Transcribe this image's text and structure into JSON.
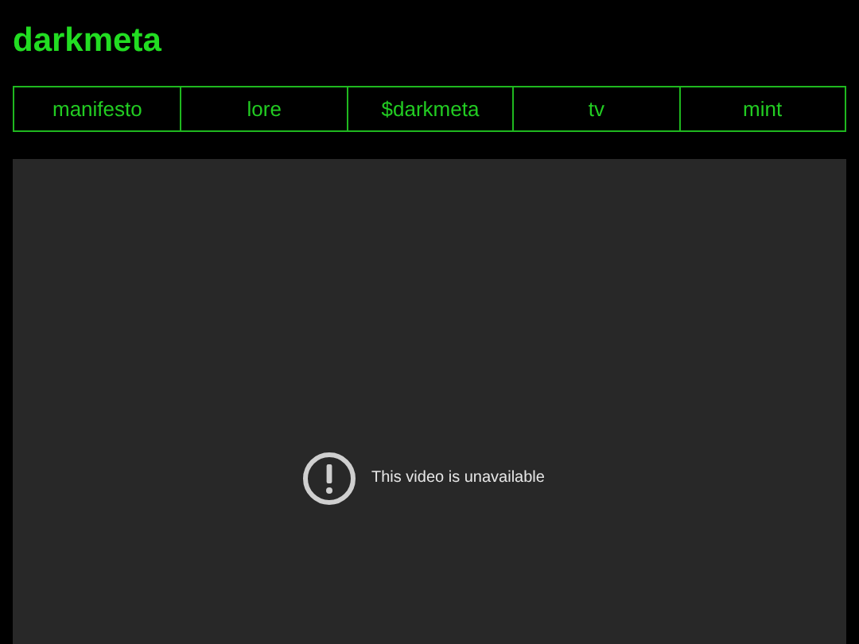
{
  "site_title": "darkmeta",
  "nav": [
    {
      "label": "manifesto"
    },
    {
      "label": "lore"
    },
    {
      "label": "$darkmeta"
    },
    {
      "label": "tv"
    },
    {
      "label": "mint"
    }
  ],
  "video": {
    "message": "This video is unavailable"
  }
}
